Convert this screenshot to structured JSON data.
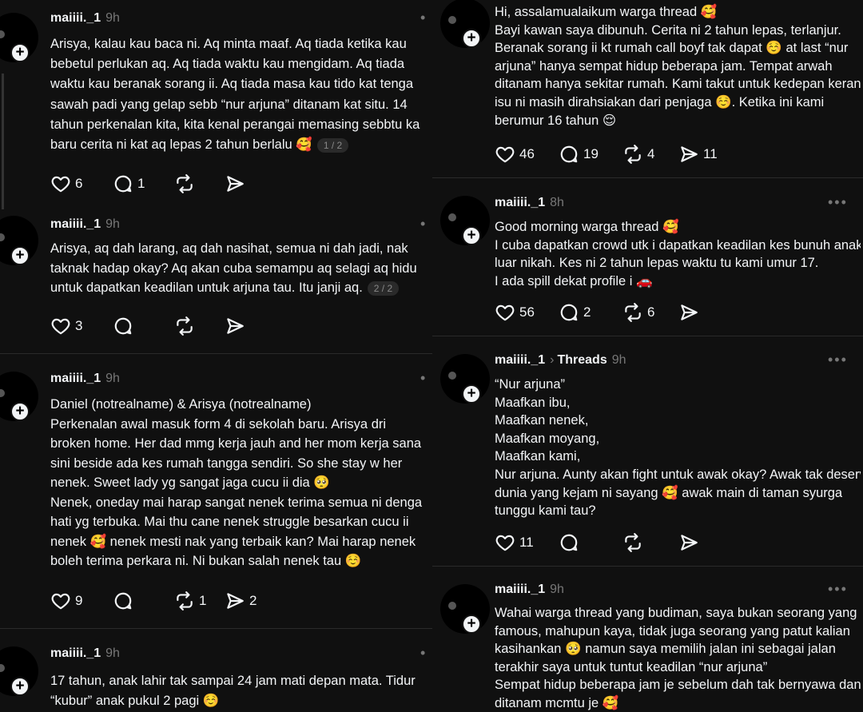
{
  "left_posts": [
    {
      "username": "maiiii._1",
      "time": "9h",
      "lines": [
        "Arisya, kalau kau baca ni. Aq minta maaf. Aq tiada ketika kau",
        "bebetul perlukan aq. Aq tiada waktu kau mengidam. Aq tiada",
        "waktu kau beranak sorang ii. Aq tiada masa kau tido kat tenga",
        "sawah padi yang gelap sebb “nur arjuna” ditanam kat situ. 14",
        "tahun perkenalan kita, kita kenal perangai memasing sebbtu ka",
        "baru cerita ni kat aq lepas 2 tahun berlalu 🥰"
      ],
      "page": "1 / 2",
      "likes": "6",
      "replies": "1",
      "reposts": "",
      "shares": ""
    },
    {
      "username": "maiiii._1",
      "time": "9h",
      "lines": [
        "Arisya, aq dah larang, aq dah nasihat, semua ni dah jadi, nak",
        "taknak hadap okay? Aq akan cuba semampu aq selagi aq hidu",
        "untuk dapatkan keadilan untuk arjuna tau. Itu janji aq."
      ],
      "page": "2 / 2",
      "likes": "3",
      "replies": "",
      "reposts": "",
      "shares": ""
    },
    {
      "username": "maiiii._1",
      "time": "9h",
      "lines": [
        "Daniel (notrealname) & Arisya (notrealname)",
        "Perkenalan awal masuk form 4 di sekolah baru. Arisya dri",
        "broken home. Her dad mmg kerja jauh and her mom kerja sana",
        "sini beside ada kes rumah tangga sendiri. So she stay w her",
        "nenek. Sweet lady yg sangat jaga cucu ii dia 🥺",
        "Nenek, oneday mai harap sangat nenek terima semua ni denga",
        "hati yg terbuka. Mai thu cane nenek struggle besarkan cucu ii",
        "nenek 🥰 nenek mesti nak yang terbaik kan? Mai harap nenek",
        "boleh terima perkara ni. Ni bukan salah nenek tau ☺️"
      ],
      "page": "",
      "likes": "9",
      "replies": "",
      "reposts": "1",
      "shares": "2"
    },
    {
      "username": "maiiii._1",
      "time": "9h",
      "lines": [
        "17 tahun, anak lahir tak sampai 24 jam mati depan mata. Tidur",
        "“kubur” anak pukul 2 pagi ☺️"
      ],
      "page": "",
      "likes": "",
      "replies": "",
      "reposts": "",
      "shares": ""
    }
  ],
  "right_posts": [
    {
      "username": "",
      "time": "",
      "crumb": "",
      "lines": [
        "Hi, assalamualaikum warga thread 🥰",
        "Bayi kawan saya dibunuh. Cerita ni 2 tahun lepas, terlanjur.",
        "Beranak sorang ii kt rumah call boyf tak dapat ☺️ at last “nur",
        "arjuna” hanya sempat hidup beberapa jam. Tempat arwah",
        "ditanam hanya sekitar rumah. Kami takut untuk kedepan kerana",
        "isu ni masih dirahsiakan dari penjaga ☺️. Ketika ini kami",
        "berumur 16 tahun 😌"
      ],
      "likes": "46",
      "replies": "19",
      "reposts": "4",
      "shares": "11"
    },
    {
      "username": "maiiii._1",
      "time": "8h",
      "crumb": "",
      "lines": [
        "Good morning warga thread 🥰",
        "I cuba dapatkan crowd utk i dapatkan keadilan kes bunuh anak",
        "luar nikah. Kes ni 2 tahun lepas waktu tu kami umur 17.",
        "I ada spill dekat profile i 🚗"
      ],
      "likes": "56",
      "replies": "2",
      "reposts": "6",
      "shares": ""
    },
    {
      "username": "maiiii._1",
      "time": "9h",
      "crumb": "Threads",
      "lines": [
        "“Nur arjuna”",
        "Maafkan ibu,",
        "Maafkan nenek,",
        "Maafkan moyang,",
        "Maafkan kami,",
        "Nur arjuna. Aunty akan fight untuk awak okay? Awak tak deserve",
        "dunia yang kejam ni sayang 🥰 awak main di taman syurga",
        "tunggu kami tau?"
      ],
      "likes": "11",
      "replies": "",
      "reposts": "",
      "shares": ""
    },
    {
      "username": "maiiii._1",
      "time": "9h",
      "crumb": "",
      "lines": [
        "Wahai warga thread yang budiman, saya bukan seorang yang",
        "famous, mahupun kaya, tidak juga seorang yang patut kalian",
        "kasihankan 🥺 namun saya memilih jalan ini sebagai jalan",
        "terakhir saya untuk tuntut keadilan “nur arjuna”",
        "Sempat hidup beberapa jam je sebelum dah tak bernyawa dan",
        "ditanam mcmtu je 🥰"
      ],
      "likes": "",
      "replies": "",
      "reposts": "",
      "shares": ""
    }
  ],
  "icons": {
    "like": "heart-icon",
    "reply": "comment-icon",
    "repost": "repost-icon",
    "share": "send-icon",
    "follow": "plus-icon",
    "more": "more-icon"
  },
  "colors": {
    "background": "#101010",
    "text": "#f3f5f7",
    "muted": "#777777"
  }
}
